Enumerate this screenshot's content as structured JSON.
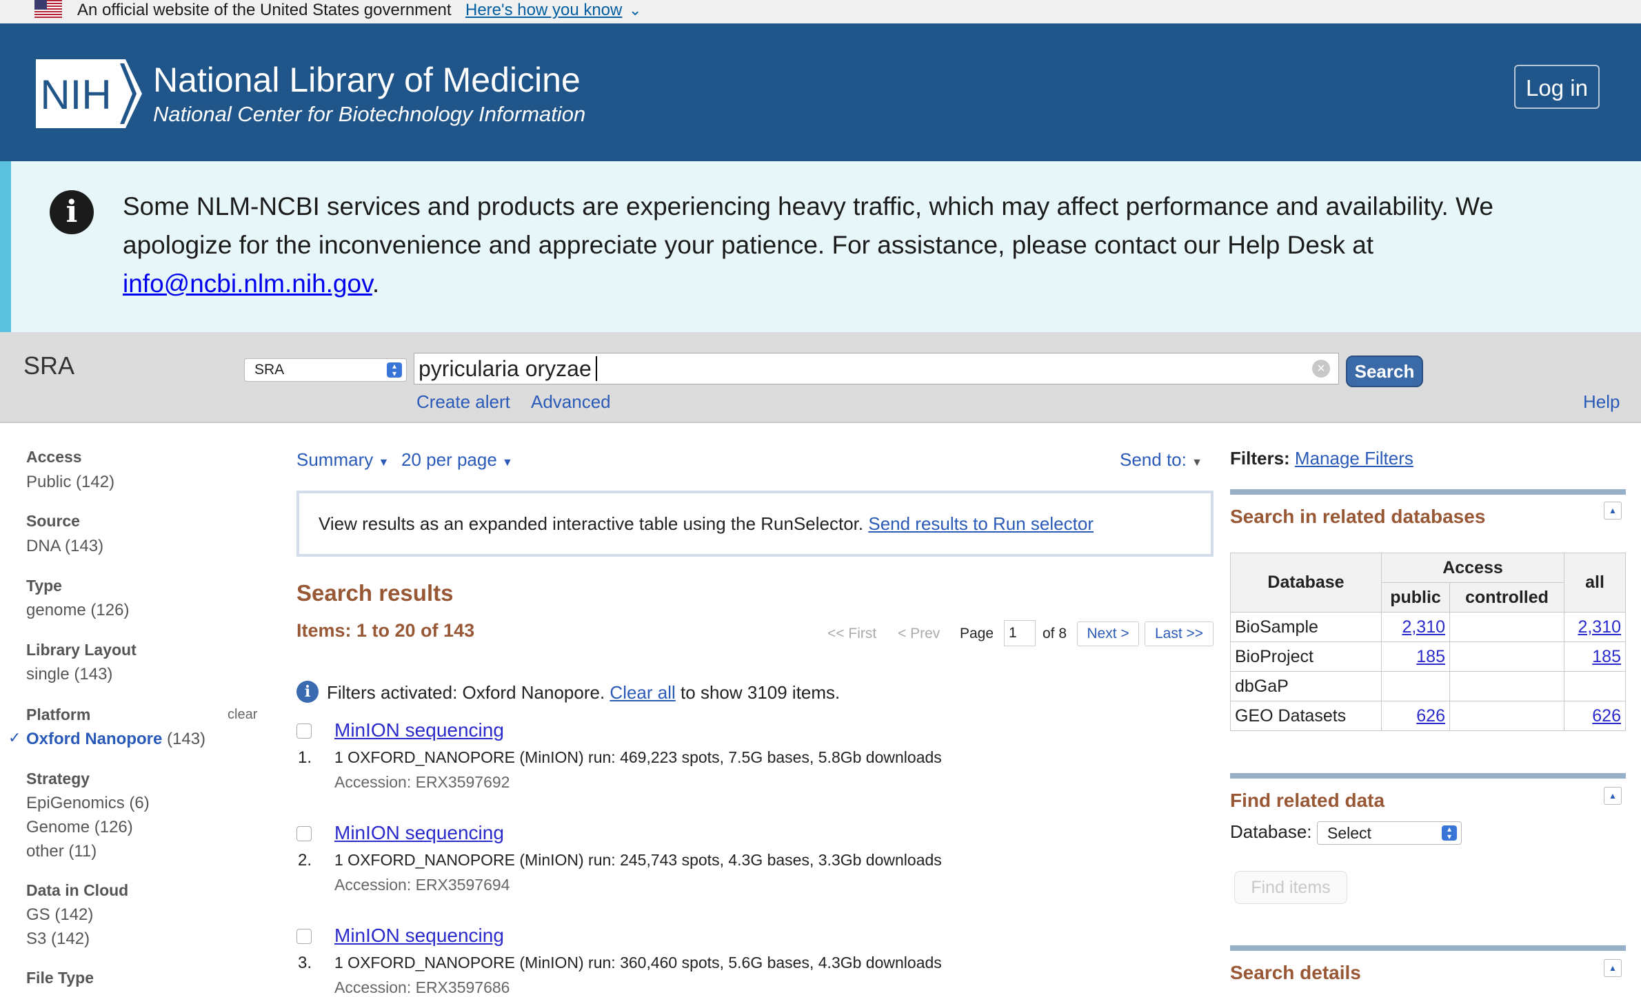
{
  "gov_banner": {
    "text": "An official website of the United States government",
    "how_link": "Here's how you know",
    "chevron": "⌄"
  },
  "header": {
    "logo_text": "NIH",
    "title": "National Library of Medicine",
    "subtitle": "National Center for Biotechnology Information",
    "login_label": "Log in",
    "bg_color": "#20558a"
  },
  "alert": {
    "icon": "info-icon",
    "text_before": "Some NLM-NCBI services and products are experiencing heavy traffic, which may affect performance and availability. We apologize for the inconvenience and appreciate your patience. For assistance, please contact our Help Desk at ",
    "email": "info@ncbi.nlm.nih.gov",
    "text_after": "."
  },
  "search_bar": {
    "database_label": "SRA",
    "database_select": "SRA",
    "term": "pyricularia oryzae",
    "search_button": "Search",
    "create_alert": "Create alert",
    "advanced": "Advanced",
    "help": "Help"
  },
  "facets": {
    "access_title": "Access",
    "access_public": "Public",
    "access_public_count": "(142)",
    "source_title": "Source",
    "source_dna": "DNA",
    "source_dna_count": "(143)",
    "type_title": "Type",
    "type_genome": "genome",
    "type_genome_count": "(126)",
    "layout_title": "Library Layout",
    "layout_single": "single",
    "layout_single_count": "(143)",
    "platform_title": "Platform",
    "platform_clear": "clear",
    "platform_selected": "Oxford Nanopore",
    "platform_selected_count": "(143)",
    "strategy_title": "Strategy",
    "strategy_1": "EpiGenomics",
    "strategy_1_count": "(6)",
    "strategy_2": "Genome",
    "strategy_2_count": "(126)",
    "strategy_3": "other",
    "strategy_3_count": "(11)",
    "cloud_title": "Data in Cloud",
    "cloud_gs": "GS",
    "cloud_gs_count": "(142)",
    "cloud_s3": "S3",
    "cloud_s3_count": "(142)",
    "filetype_title": "File Type"
  },
  "display": {
    "summary": "Summary",
    "per_page": "20 per page",
    "send_to": "Send to:"
  },
  "run_selector": {
    "text": "View results as an expanded interactive table using the RunSelector.",
    "link": "Send results to Run selector"
  },
  "results": {
    "heading": "Search results",
    "items_label": "Items: 1 to 20 of 143",
    "pager": {
      "first": "<< First",
      "prev": "< Prev",
      "page_label": "Page",
      "page": "1",
      "of": "of 8",
      "next": "Next >",
      "last": "Last >>"
    },
    "filters_text": "Filters activated: Oxford Nanopore.",
    "clear_all": "Clear all",
    "filters_after": "to show 3109 items.",
    "items": [
      {
        "num": "1.",
        "title": "MinION sequencing",
        "desc": "1 OXFORD_NANOPORE (MinION) run: 469,223 spots, 7.5G bases, 5.8Gb downloads",
        "accession": "Accession: ERX3597692"
      },
      {
        "num": "2.",
        "title": "MinION sequencing",
        "desc": "1 OXFORD_NANOPORE (MinION) run: 245,743 spots, 4.3G bases, 3.3Gb downloads",
        "accession": "Accession: ERX3597694"
      },
      {
        "num": "3.",
        "title": "MinION sequencing",
        "desc": "1 OXFORD_NANOPORE (MinION) run: 360,460 spots, 5.6G bases, 4.3Gb downloads",
        "accession": "Accession: ERX3597686"
      }
    ]
  },
  "right": {
    "filters_label": "Filters:",
    "manage_filters": "Manage Filters",
    "related_title": "Search in related databases",
    "table": {
      "h_database": "Database",
      "h_access": "Access",
      "h_all": "all",
      "h_public": "public",
      "h_controlled": "controlled",
      "rows": [
        {
          "db": "BioSample",
          "public": "2,310",
          "controlled": "",
          "all": "2,310"
        },
        {
          "db": "BioProject",
          "public": "185",
          "controlled": "",
          "all": "185"
        },
        {
          "db": "dbGaP",
          "public": "",
          "controlled": "",
          "all": ""
        },
        {
          "db": "GEO Datasets",
          "public": "626",
          "controlled": "",
          "all": "626"
        }
      ]
    },
    "find_title": "Find related data",
    "database_label": "Database:",
    "database_select": "Select",
    "find_items": "Find items",
    "details_title": "Search details"
  }
}
